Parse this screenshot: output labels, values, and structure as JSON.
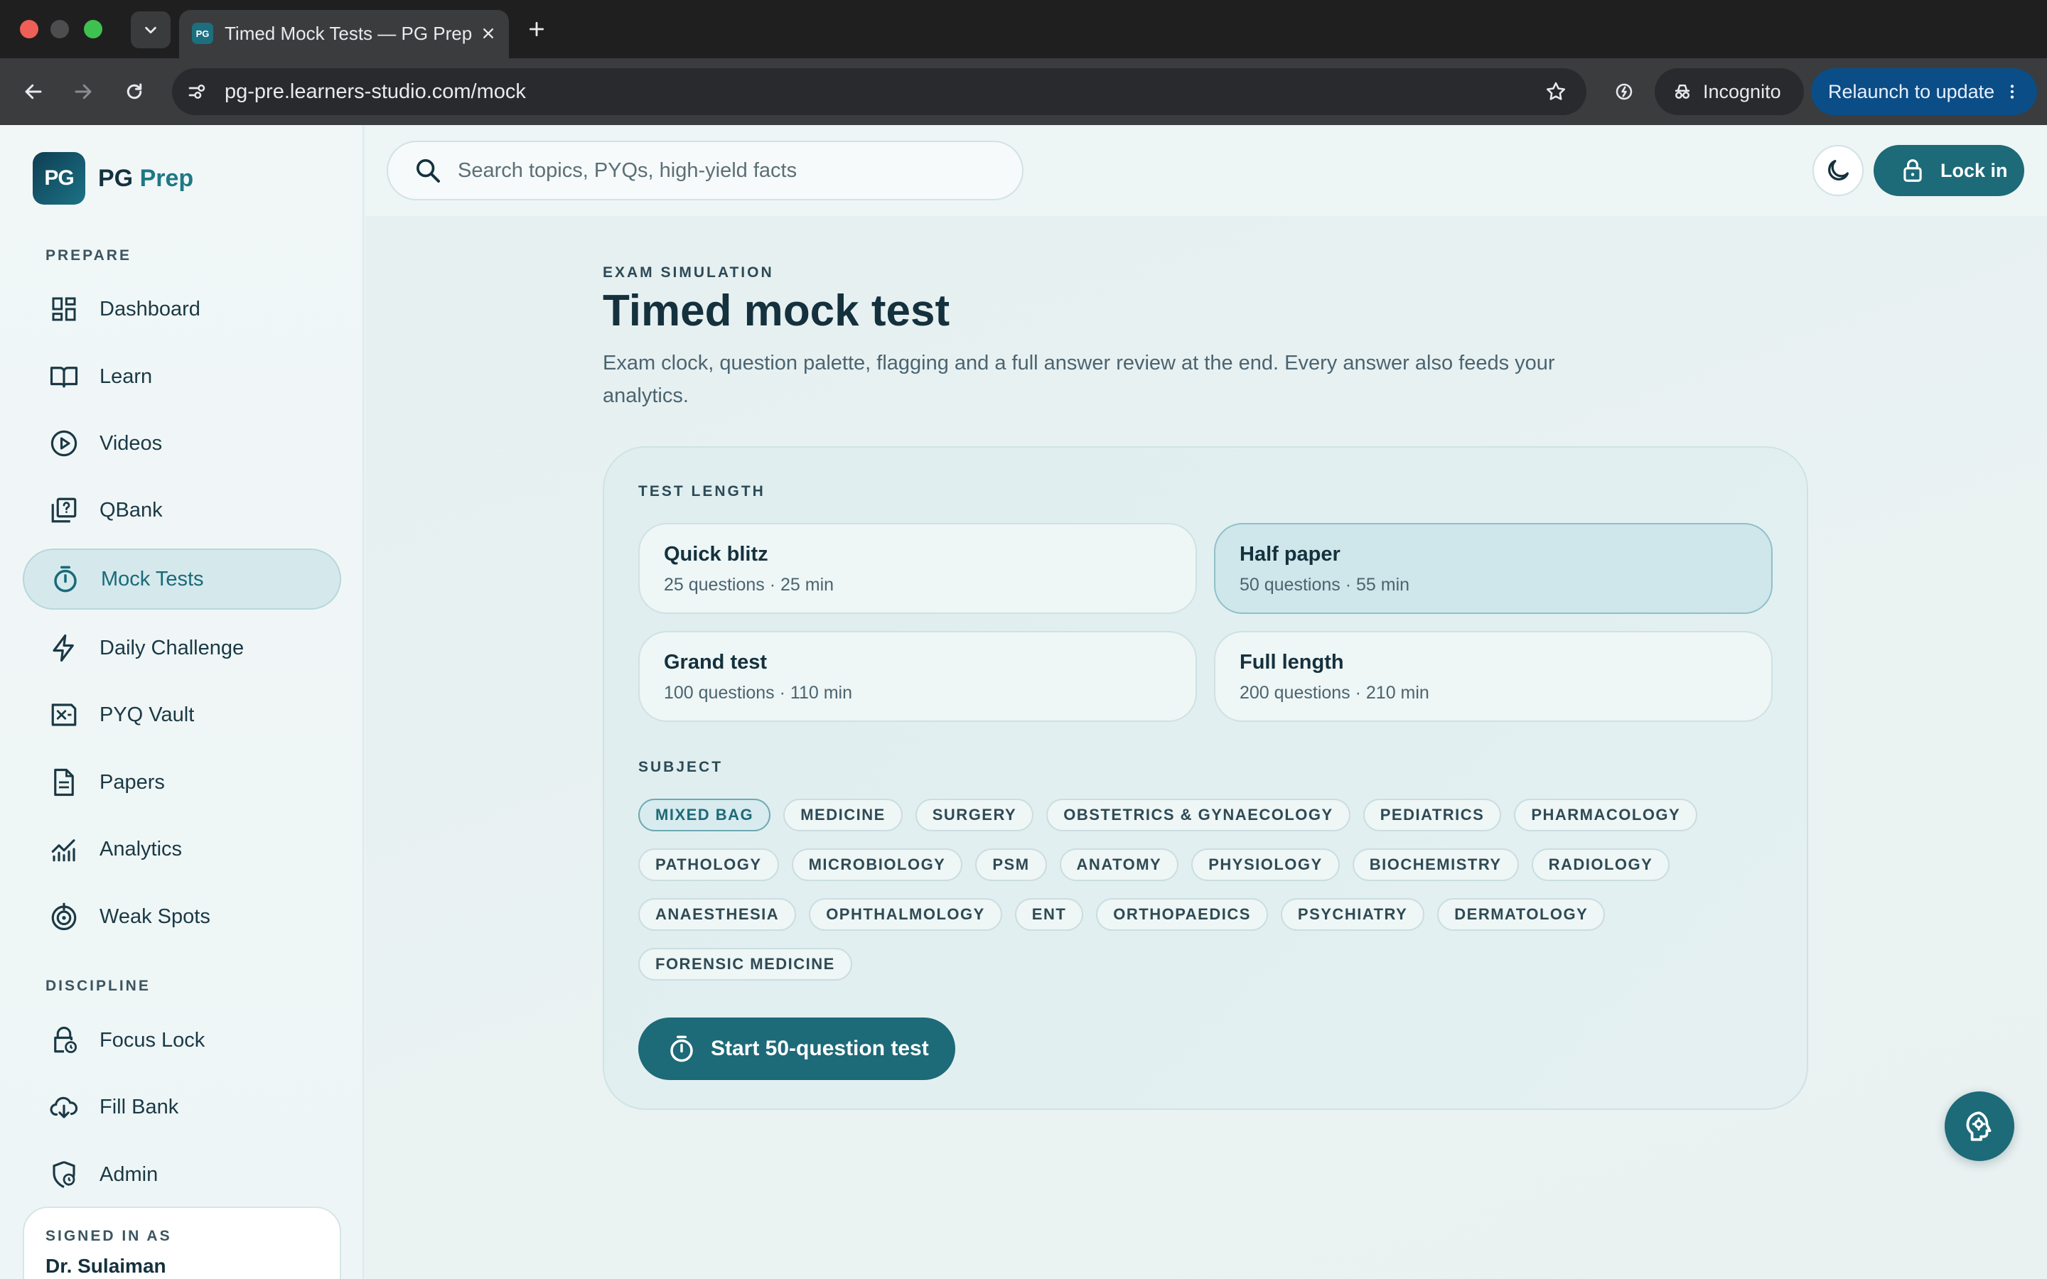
{
  "browser": {
    "tab_title": "Timed Mock Tests — PG Prep",
    "tab_favicon": "PG",
    "url": "pg-pre.learners-studio.com/mock",
    "incognito_label": "Incognito",
    "relaunch_label": "Relaunch to update"
  },
  "brand": {
    "logo_text": "PG",
    "name_part1": "PG",
    "name_part2": "Prep",
    "accent_color": "#1e7885"
  },
  "sidebar": {
    "prepare_label": "PREPARE",
    "discipline_label": "DISCIPLINE",
    "prepare_items": [
      {
        "label": "Dashboard",
        "icon": "dashboard-icon"
      },
      {
        "label": "Learn",
        "icon": "book-icon"
      },
      {
        "label": "Videos",
        "icon": "play-icon"
      },
      {
        "label": "QBank",
        "icon": "question-bank-icon"
      },
      {
        "label": "Mock Tests",
        "icon": "stopwatch-icon",
        "active": true
      },
      {
        "label": "Daily Challenge",
        "icon": "lightning-icon"
      },
      {
        "label": "PYQ Vault",
        "icon": "vault-icon"
      },
      {
        "label": "Papers",
        "icon": "document-icon"
      },
      {
        "label": "Analytics",
        "icon": "analytics-icon"
      },
      {
        "label": "Weak Spots",
        "icon": "target-icon"
      }
    ],
    "discipline_items": [
      {
        "label": "Focus Lock",
        "icon": "lock-clock-icon"
      },
      {
        "label": "Fill Bank",
        "icon": "cloud-download-icon"
      },
      {
        "label": "Admin",
        "icon": "shield-clock-icon"
      }
    ],
    "signed_in_label": "SIGNED IN AS",
    "signed_in_name": "Dr. Sulaiman"
  },
  "topbar": {
    "search_placeholder": "Search topics, PYQs, high-yield facts",
    "lock_label": "Lock in"
  },
  "main": {
    "eyebrow": "EXAM SIMULATION",
    "title": "Timed mock test",
    "description": "Exam clock, question palette, flagging and a full answer review at the end. Every answer also feeds your analytics.",
    "test_length_label": "TEST LENGTH",
    "test_lengths": [
      {
        "name": "Quick blitz",
        "meta": "25 questions · 25 min",
        "selected": false
      },
      {
        "name": "Half paper",
        "meta": "50 questions · 55 min",
        "selected": true
      },
      {
        "name": "Grand test",
        "meta": "100 questions · 110 min",
        "selected": false
      },
      {
        "name": "Full length",
        "meta": "200 questions · 210 min",
        "selected": false
      }
    ],
    "subject_label": "SUBJECT",
    "subjects": [
      [
        "MIXED BAG",
        "MEDICINE",
        "SURGERY",
        "OBSTETRICS & GYNAECOLOGY",
        "PEDIATRICS",
        "PHARMACOLOGY"
      ],
      [
        "PATHOLOGY",
        "MICROBIOLOGY",
        "PSM",
        "ANATOMY",
        "PHYSIOLOGY",
        "BIOCHEMISTRY",
        "RADIOLOGY"
      ],
      [
        "ANAESTHESIA",
        "OPHTHALMOLOGY",
        "ENT",
        "ORTHOPAEDICS",
        "PSYCHIATRY",
        "DERMATOLOGY"
      ],
      [
        "FORENSIC MEDICINE"
      ]
    ],
    "selected_subject": "MIXED BAG",
    "start_label": "Start 50-question test"
  },
  "colors": {
    "primary": "#1d6a78",
    "selected_bg": "#cfe6ea"
  }
}
